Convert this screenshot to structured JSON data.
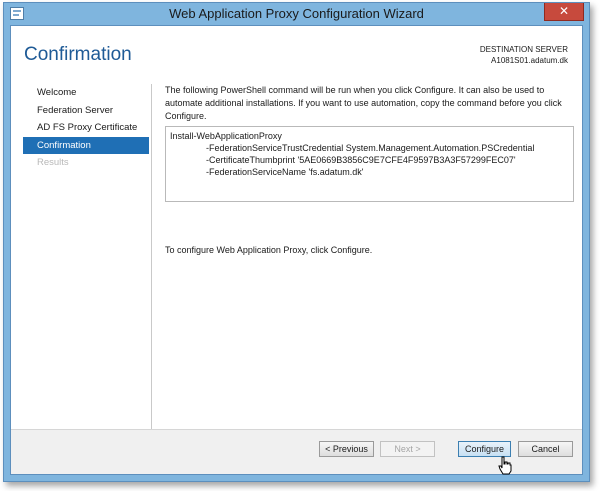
{
  "window": {
    "title": "Web Application Proxy Configuration Wizard",
    "close_glyph": "✕"
  },
  "header": {
    "page_title": "Confirmation",
    "destination_label": "DESTINATION SERVER",
    "destination_server": "A1081S01.adatum.dk"
  },
  "nav": {
    "items": [
      {
        "label": "Welcome",
        "state": "normal"
      },
      {
        "label": "Federation Server",
        "state": "normal"
      },
      {
        "label": "AD FS Proxy Certificate",
        "state": "normal"
      },
      {
        "label": "Confirmation",
        "state": "active"
      },
      {
        "label": "Results",
        "state": "disabled"
      }
    ]
  },
  "content": {
    "intro": "The following PowerShell command will be run when you click Configure. It can also be used to automate additional installations. If you want to use automation, copy the command before you click Configure.",
    "command_lines": [
      "Install-WebApplicationProxy",
      "-FederationServiceTrustCredential System.Management.Automation.PSCredential",
      "-CertificateThumbprint '5AE0669B3856C9E7CFE4F9597B3A3F57299FEC07'",
      "-FederationServiceName 'fs.adatum.dk'"
    ],
    "footer": "To configure Web Application Proxy, click Configure."
  },
  "buttons": {
    "previous": "< Previous",
    "next": "Next >",
    "configure": "Configure",
    "cancel": "Cancel"
  },
  "colors": {
    "accent": "#1f6fb5",
    "title_blue": "#1e5a96",
    "frame": "#7fb5de",
    "close_red": "#c74a3d"
  }
}
